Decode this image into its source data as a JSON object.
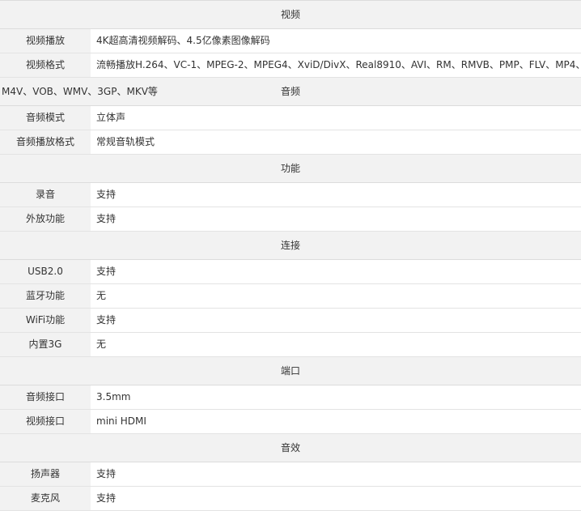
{
  "sections": {
    "video": {
      "title": "视频",
      "rows": [
        {
          "label": "视频播放",
          "value": "4K超高清视频解码、4.5亿像素图像解码"
        },
        {
          "label": "视频格式",
          "value": "流畅播放H.264、VC-1、MPEG-2、MPEG4、XviD/DivX、Real8910、AVI、RM、RMVB、PMP、FLV、MP4、",
          "value_cont": "M4V、VOB、WMV、3GP、MKV等"
        }
      ]
    },
    "audio": {
      "title": "音频",
      "rows": [
        {
          "label": "音频模式",
          "value": "立体声"
        },
        {
          "label": "音频播放格式",
          "value": "常规音轨模式"
        }
      ]
    },
    "function": {
      "title": "功能",
      "rows": [
        {
          "label": "录音",
          "value": "支持"
        },
        {
          "label": "外放功能",
          "value": "支持"
        }
      ]
    },
    "connect": {
      "title": "连接",
      "rows": [
        {
          "label": "USB2.0",
          "value": "支持"
        },
        {
          "label": "蓝牙功能",
          "value": "无"
        },
        {
          "label": "WiFi功能",
          "value": "支持"
        },
        {
          "label": "内置3G",
          "value": "无"
        }
      ]
    },
    "ports": {
      "title": "端口",
      "rows": [
        {
          "label": "音频接口",
          "value": "3.5mm"
        },
        {
          "label": "视频接口",
          "value": "mini HDMI"
        }
      ]
    },
    "sound": {
      "title": "音效",
      "rows": [
        {
          "label": "扬声器",
          "value": "支持"
        },
        {
          "label": "麦克风",
          "value": "支持"
        }
      ]
    }
  }
}
